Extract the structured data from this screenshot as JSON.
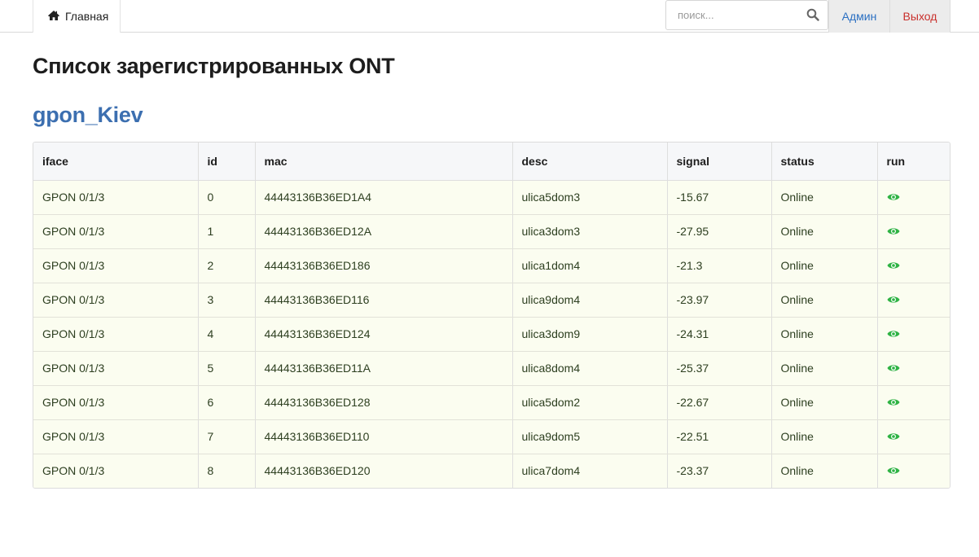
{
  "nav": {
    "home_label": "Главная",
    "search_placeholder": "поиск...",
    "admin_label": "Админ",
    "logout_label": "Выход"
  },
  "page": {
    "title": "Список зарегистрированных ONT",
    "olt_name": "gpon_Kiev"
  },
  "table": {
    "headers": [
      "iface",
      "id",
      "mac",
      "desc",
      "signal",
      "status",
      "run"
    ],
    "rows": [
      {
        "iface": "GPON 0/1/3",
        "id": "0",
        "mac": "44443136B36ED1A4",
        "desc": "ulica5dom3",
        "signal": "-15.67",
        "status": "Online",
        "run_icon": "eye-icon"
      },
      {
        "iface": "GPON 0/1/3",
        "id": "1",
        "mac": "44443136B36ED12A",
        "desc": "ulica3dom3",
        "signal": "-27.95",
        "status": "Online",
        "run_icon": "eye-icon"
      },
      {
        "iface": "GPON 0/1/3",
        "id": "2",
        "mac": "44443136B36ED186",
        "desc": "ulica1dom4",
        "signal": "-21.3",
        "status": "Online",
        "run_icon": "eye-icon"
      },
      {
        "iface": "GPON 0/1/3",
        "id": "3",
        "mac": "44443136B36ED116",
        "desc": "ulica9dom4",
        "signal": "-23.97",
        "status": "Online",
        "run_icon": "eye-icon"
      },
      {
        "iface": "GPON 0/1/3",
        "id": "4",
        "mac": "44443136B36ED124",
        "desc": "ulica3dom9",
        "signal": "-24.31",
        "status": "Online",
        "run_icon": "eye-icon"
      },
      {
        "iface": "GPON 0/1/3",
        "id": "5",
        "mac": "44443136B36ED11A",
        "desc": "ulica8dom4",
        "signal": "-25.37",
        "status": "Online",
        "run_icon": "eye-icon"
      },
      {
        "iface": "GPON 0/1/3",
        "id": "6",
        "mac": "44443136B36ED128",
        "desc": "ulica5dom2",
        "signal": "-22.67",
        "status": "Online",
        "run_icon": "eye-icon"
      },
      {
        "iface": "GPON 0/1/3",
        "id": "7",
        "mac": "44443136B36ED110",
        "desc": "ulica9dom5",
        "signal": "-22.51",
        "status": "Online",
        "run_icon": "eye-icon"
      },
      {
        "iface": "GPON 0/1/3",
        "id": "8",
        "mac": "44443136B36ED120",
        "desc": "ulica7dom4",
        "signal": "-23.37",
        "status": "Online",
        "run_icon": "eye-icon"
      }
    ]
  },
  "colors": {
    "link_blue": "#2a6fc2",
    "olt_title": "#3c6fb0",
    "logout_red": "#c9302c",
    "row_bg": "#fbfdf0",
    "eye_green": "#2fb344"
  },
  "icons": {
    "home": "home-icon",
    "search": "search-icon",
    "run": "eye-icon"
  }
}
